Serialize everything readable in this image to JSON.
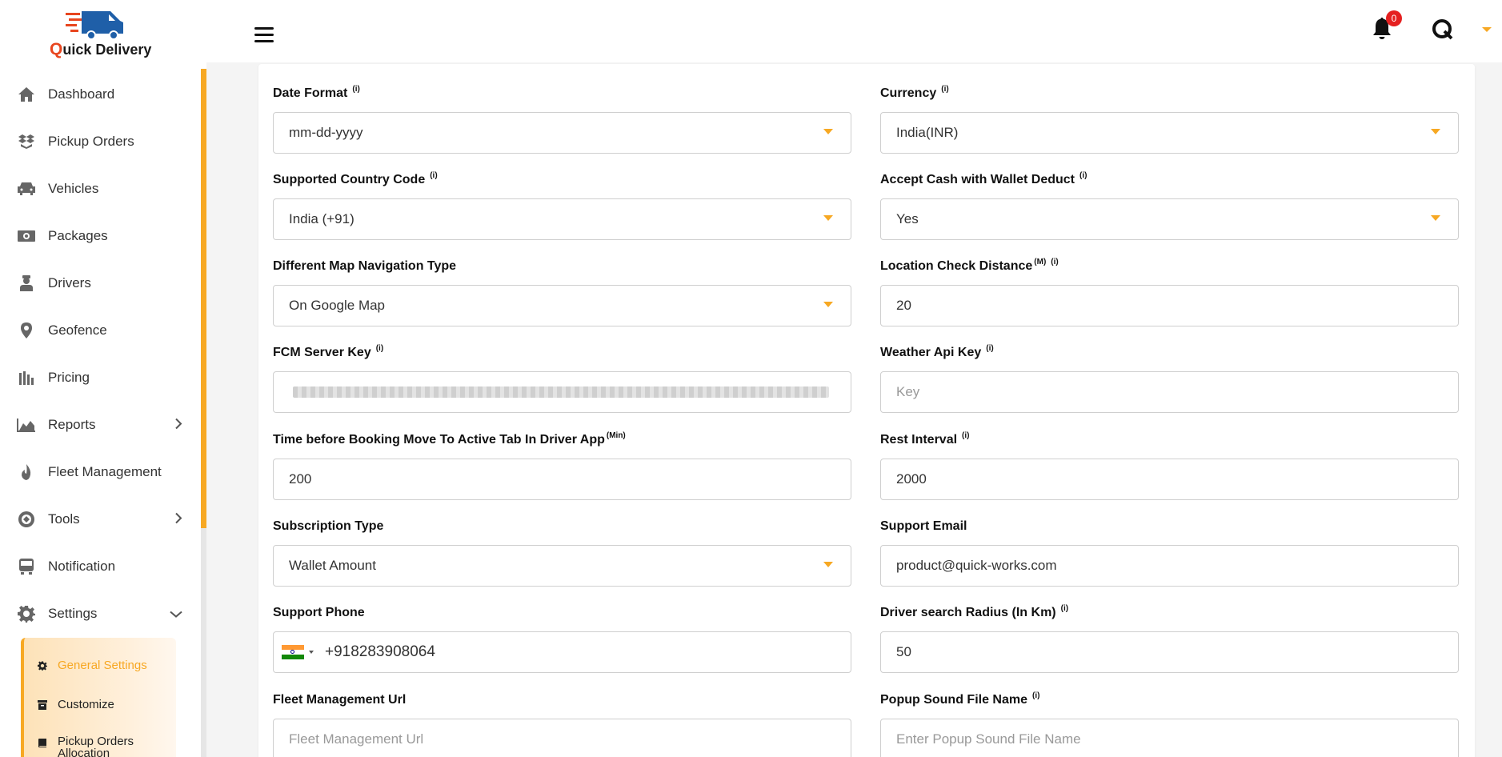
{
  "app": {
    "logo_text_q": "Q",
    "logo_text_rest": "uick Delivery"
  },
  "sidebar": {
    "items": [
      {
        "label": "Dashboard",
        "icon": "home-icon"
      },
      {
        "label": "Pickup Orders",
        "icon": "boxes-icon"
      },
      {
        "label": "Vehicles",
        "icon": "car-icon"
      },
      {
        "label": "Packages",
        "icon": "money-icon"
      },
      {
        "label": "Drivers",
        "icon": "driver-icon"
      },
      {
        "label": "Geofence",
        "icon": "map-pin-icon"
      },
      {
        "label": "Pricing",
        "icon": "pricing-icon"
      },
      {
        "label": "Reports",
        "icon": "chart-area-icon",
        "expandable": true
      },
      {
        "label": "Fleet Management",
        "icon": "fire-icon"
      },
      {
        "label": "Tools",
        "icon": "tools-icon",
        "expandable": true
      },
      {
        "label": "Notification",
        "icon": "bus-icon"
      },
      {
        "label": "Settings",
        "icon": "gear-icon",
        "expanded": true
      }
    ],
    "settings_sub": [
      {
        "label": "General Settings",
        "active": true
      },
      {
        "label": "Customize"
      },
      {
        "label": "Pickup Orders Allocation"
      }
    ]
  },
  "header": {
    "notification_count": "0"
  },
  "form": {
    "date_format": {
      "label": "Date Format",
      "value": "mm-dd-yyyy"
    },
    "currency": {
      "label": "Currency",
      "value": "India(INR)"
    },
    "country_code": {
      "label": "Supported Country Code",
      "value": "India (+91)"
    },
    "cash_wallet": {
      "label": "Accept Cash with Wallet Deduct",
      "value": "Yes"
    },
    "map_nav": {
      "label": "Different Map Navigation Type",
      "value": "On Google Map"
    },
    "location_distance": {
      "label": "Location Check Distance",
      "sup": "(M)",
      "value": "20"
    },
    "fcm_key": {
      "label": "FCM Server Key"
    },
    "weather_key": {
      "label": "Weather Api Key",
      "placeholder": "Key"
    },
    "booking_move": {
      "label": "Time before Booking Move To Active Tab In Driver App",
      "sup": "(Min)",
      "value": "200"
    },
    "rest_interval": {
      "label": "Rest Interval",
      "value": "2000"
    },
    "subscription": {
      "label": "Subscription Type",
      "value": "Wallet Amount"
    },
    "support_email": {
      "label": "Support Email",
      "value": "product@quick-works.com"
    },
    "support_phone": {
      "label": "Support Phone",
      "value": "+918283908064"
    },
    "search_radius": {
      "label": "Driver search Radius (In Km)",
      "value": "50"
    },
    "fleet_url": {
      "label": "Fleet Management Url",
      "placeholder": "Fleet Management Url"
    },
    "popup_sound": {
      "label": "Popup Sound File Name",
      "placeholder": "Enter Popup Sound File Name"
    }
  },
  "colors": {
    "accent": "#f7a823",
    "badge": "#e52020",
    "logo_red": "#e8461f",
    "logo_blue": "#1f5fa8"
  }
}
